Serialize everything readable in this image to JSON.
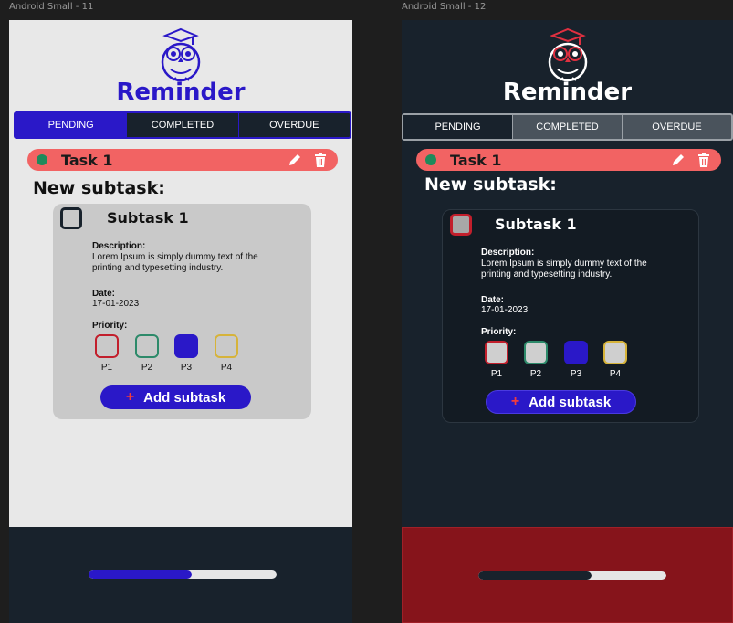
{
  "colors": {
    "brand_blue": "#2a18c8",
    "task_red": "#f26363",
    "status_green": "#1f8a5b",
    "p1": "#c21f2c",
    "p2": "#2d8a6a",
    "p3": "#2a18c8",
    "p4": "#d6b33a",
    "dark_bg": "#18222c",
    "dark_footer": "#86141b"
  },
  "frames": [
    {
      "label": "Android Small - 11",
      "theme": "light",
      "title": "Reminder",
      "tabs": [
        {
          "label": "PENDING",
          "active": true
        },
        {
          "label": "COMPLETED",
          "active": false
        },
        {
          "label": "OVERDUE",
          "active": false
        }
      ],
      "task": {
        "title": "Task 1",
        "edit_icon": "pencil-icon",
        "delete_icon": "trash-icon"
      },
      "subtask_heading": "New subtask:",
      "subtask": {
        "title": "Subtask 1",
        "checked": false,
        "description_label": "Description:",
        "description_text": "Lorem Ipsum is simply dummy text of the printing and typesetting industry.",
        "date_label": "Date:",
        "date_value": "17-01-2023",
        "priority_label": "Priority:",
        "priorities": [
          "P1",
          "P2",
          "P3",
          "P4"
        ],
        "selected_priority": "P3",
        "add_label": "Add subtask",
        "add_icon": "plus-icon"
      },
      "progress": 0.55
    },
    {
      "label": "Android Small - 12",
      "theme": "dark",
      "title": "Reminder",
      "tabs": [
        {
          "label": "PENDING",
          "active": true
        },
        {
          "label": "COMPLETED",
          "active": false
        },
        {
          "label": "OVERDUE",
          "active": false
        }
      ],
      "task": {
        "title": "Task 1",
        "edit_icon": "pencil-icon",
        "delete_icon": "trash-icon"
      },
      "subtask_heading": "New subtask:",
      "subtask": {
        "title": "Subtask 1",
        "checked": false,
        "description_label": "Description:",
        "description_text": "Lorem Ipsum is simply dummy text of the printing and typesetting industry.",
        "date_label": "Date:",
        "date_value": "17-01-2023",
        "priority_label": "Priority:",
        "priorities": [
          "P1",
          "P2",
          "P3",
          "P4"
        ],
        "selected_priority": "P3",
        "add_label": "Add subtask",
        "add_icon": "plus-icon"
      },
      "progress": 0.6
    }
  ]
}
